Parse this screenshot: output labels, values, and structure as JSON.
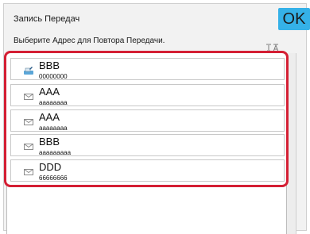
{
  "header": {
    "title": "Запись Передач",
    "ok_label": "OK"
  },
  "instruction": "Выберите Адрес для Повтора Передачи.",
  "sort_icon": "sort-icon",
  "entries": [
    {
      "name": "BBB",
      "number": "00000000",
      "icon": "fax-icon"
    },
    {
      "name": "AAA",
      "number": "aaaaaaaa",
      "icon": "email-icon"
    },
    {
      "name": "AAA",
      "number": "aaaaaaaa",
      "icon": "email-icon"
    },
    {
      "name": "BBB",
      "number": "aaaaaaaaa",
      "icon": "email-icon"
    },
    {
      "name": "DDD",
      "number": "66666666",
      "icon": "email-icon"
    }
  ],
  "colors": {
    "accent": "#35b1e8",
    "highlight": "#d41f34"
  }
}
